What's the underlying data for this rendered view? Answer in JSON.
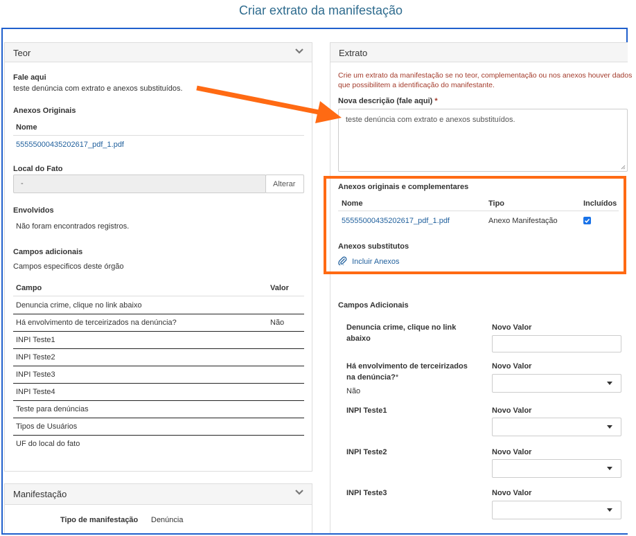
{
  "page_title": "Criar extrato da manifestação",
  "teor": {
    "title": "Teor",
    "fale_aqui_label": "Fale aqui",
    "fale_aqui_value": "teste denúncia com extrato e anexos substituídos.",
    "anexos_originais_label": "Anexos Originais",
    "anexos_table_header": "Nome",
    "anexo_file": "55555000435202617_pdf_1.pdf",
    "local_fato_label": "Local do Fato",
    "local_fato_value": "-",
    "alterar_label": "Alterar",
    "envolvidos_label": "Envolvidos",
    "envolvidos_empty": "Não foram encontrados registros.",
    "campos_adicionais_label": "Campos adicionais",
    "campos_adicionais_desc": "Campos especificos deste órgão",
    "campos_header_campo": "Campo",
    "campos_header_valor": "Valor",
    "campos": [
      {
        "campo": "Denuncia crime, clique no link abaixo",
        "valor": ""
      },
      {
        "campo": "Há envolvimento de terceirizados na denúncia?",
        "valor": "Não"
      },
      {
        "campo": "INPI Teste1",
        "valor": ""
      },
      {
        "campo": "INPI Teste2",
        "valor": ""
      },
      {
        "campo": "INPI Teste3",
        "valor": ""
      },
      {
        "campo": "INPI Teste4",
        "valor": ""
      },
      {
        "campo": "Teste para denúncias",
        "valor": ""
      },
      {
        "campo": "Tipos de Usuários",
        "valor": ""
      },
      {
        "campo": "UF do local do fato",
        "valor": ""
      }
    ]
  },
  "manifestacao": {
    "title": "Manifestação",
    "tipo_label": "Tipo de manifestação",
    "tipo_value": "Denúncia"
  },
  "extrato": {
    "title": "Extrato",
    "warning": "Crie um extrato da manifestação se no teor, complementação ou nos anexos houver dados que possibilitem a identificação do manifestante.",
    "warning_line1": "Crie um extrato da manifestação se no teor, complementação ou nos anexos houver dados",
    "warning_line2": "que possibilitem a identificação do manifestante.",
    "nova_descricao_label": "Nova descrição (fale aqui)",
    "required_mark": "*",
    "nova_descricao_value": "teste denúncia com extrato e anexos substituídos.",
    "anexos_orig_comp_label": "Anexos originais e complementares",
    "anexos_headers": {
      "nome": "Nome",
      "tipo": "Tipo",
      "incluidos": "Incluídos"
    },
    "anexo_row": {
      "nome": "55555000435202617_pdf_1.pdf",
      "tipo": "Anexo Manifestação",
      "incluido": true
    },
    "anexos_substitutos_label": "Anexos substitutos",
    "incluir_anexos_label": "Incluir Anexos",
    "campos_adicionais_label": "Campos Adicionais",
    "novo_valor_label": "Novo Valor",
    "campos": [
      {
        "label_line1": "Denuncia crime, clique no link",
        "label_line2": "abaixo",
        "sub": ""
      },
      {
        "label_line1": "Há envolvimento de terceirizados",
        "label_line2": "na denúncia?",
        "required": "*",
        "sub": "Não"
      },
      {
        "label_line1": "INPI Teste1",
        "label_line2": "",
        "sub": ""
      },
      {
        "label_line1": "INPI Teste2",
        "label_line2": "",
        "sub": ""
      },
      {
        "label_line1": "INPI Teste3",
        "label_line2": "",
        "sub": ""
      }
    ]
  },
  "colors": {
    "accent_blue": "#1f5fcc",
    "highlight_orange": "#ff6a13",
    "link_blue": "#1f5f9c",
    "warning_red": "#a33a2a",
    "title_blue": "#2e6b8e"
  }
}
